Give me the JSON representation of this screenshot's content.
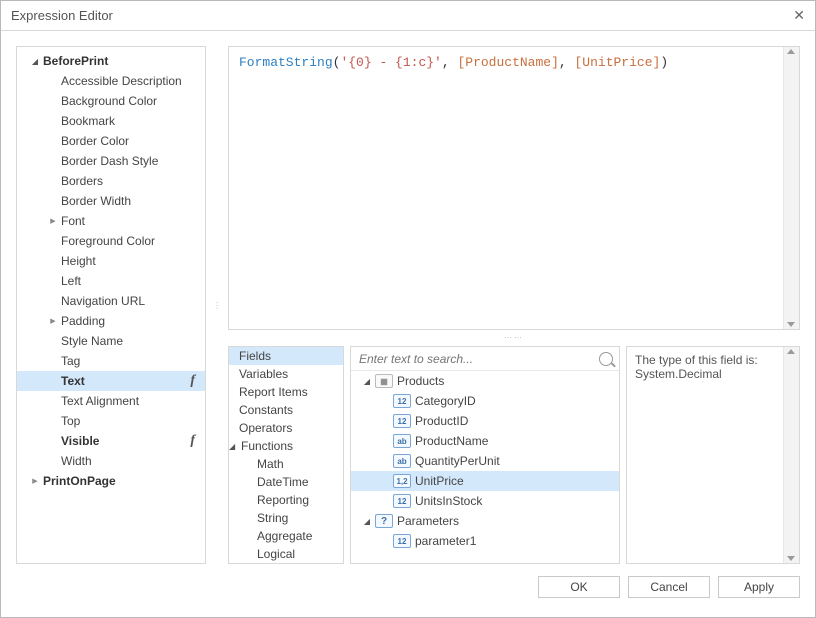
{
  "window": {
    "title": "Expression Editor"
  },
  "left_tree": [
    {
      "label": "BeforePrint",
      "depth": 0,
      "arrow": "down",
      "bold": true,
      "fx": false,
      "selected": false
    },
    {
      "label": "Accessible Description",
      "depth": 1,
      "arrow": "none",
      "bold": false,
      "fx": false
    },
    {
      "label": "Background Color",
      "depth": 1,
      "arrow": "none",
      "bold": false,
      "fx": false
    },
    {
      "label": "Bookmark",
      "depth": 1,
      "arrow": "none",
      "bold": false,
      "fx": false
    },
    {
      "label": "Border Color",
      "depth": 1,
      "arrow": "none",
      "bold": false,
      "fx": false
    },
    {
      "label": "Border Dash Style",
      "depth": 1,
      "arrow": "none",
      "bold": false,
      "fx": false
    },
    {
      "label": "Borders",
      "depth": 1,
      "arrow": "none",
      "bold": false,
      "fx": false
    },
    {
      "label": "Border Width",
      "depth": 1,
      "arrow": "none",
      "bold": false,
      "fx": false
    },
    {
      "label": "Font",
      "depth": 1,
      "arrow": "right",
      "bold": false,
      "fx": false
    },
    {
      "label": "Foreground Color",
      "depth": 1,
      "arrow": "none",
      "bold": false,
      "fx": false
    },
    {
      "label": "Height",
      "depth": 1,
      "arrow": "none",
      "bold": false,
      "fx": false
    },
    {
      "label": "Left",
      "depth": 1,
      "arrow": "none",
      "bold": false,
      "fx": false
    },
    {
      "label": "Navigation URL",
      "depth": 1,
      "arrow": "none",
      "bold": false,
      "fx": false
    },
    {
      "label": "Padding",
      "depth": 1,
      "arrow": "right",
      "bold": false,
      "fx": false
    },
    {
      "label": "Style Name",
      "depth": 1,
      "arrow": "none",
      "bold": false,
      "fx": false
    },
    {
      "label": "Tag",
      "depth": 1,
      "arrow": "none",
      "bold": false,
      "fx": false
    },
    {
      "label": "Text",
      "depth": 1,
      "arrow": "none",
      "bold": true,
      "fx": true,
      "selected": true
    },
    {
      "label": "Text Alignment",
      "depth": 1,
      "arrow": "none",
      "bold": false,
      "fx": false
    },
    {
      "label": "Top",
      "depth": 1,
      "arrow": "none",
      "bold": false,
      "fx": false
    },
    {
      "label": "Visible",
      "depth": 1,
      "arrow": "none",
      "bold": true,
      "fx": true
    },
    {
      "label": "Width",
      "depth": 1,
      "arrow": "none",
      "bold": false,
      "fx": false
    },
    {
      "label": "PrintOnPage",
      "depth": 0,
      "arrow": "right",
      "bold": true,
      "fx": false
    }
  ],
  "expression": {
    "fn": "FormatString",
    "open": "(",
    "str": "'{0} - {1:c}'",
    "sep1": ", ",
    "field1": "[ProductName]",
    "sep2": ", ",
    "field2": "[UnitPrice]",
    "close": ")"
  },
  "categories": [
    {
      "label": "Fields",
      "sub": false,
      "selected": true
    },
    {
      "label": "Variables",
      "sub": false
    },
    {
      "label": "Report Items",
      "sub": false
    },
    {
      "label": "Constants",
      "sub": false
    },
    {
      "label": "Operators",
      "sub": false
    },
    {
      "label": "Functions",
      "sub": false,
      "arrow": "down"
    },
    {
      "label": "Math",
      "sub": true
    },
    {
      "label": "DateTime",
      "sub": true
    },
    {
      "label": "Reporting",
      "sub": true
    },
    {
      "label": "String",
      "sub": true
    },
    {
      "label": "Aggregate",
      "sub": true
    },
    {
      "label": "Logical",
      "sub": true
    }
  ],
  "search": {
    "placeholder": "Enter text to search..."
  },
  "fields_tree": [
    {
      "label": "Products",
      "depth": 0,
      "arrow": "down",
      "icon": "grid"
    },
    {
      "label": "CategoryID",
      "depth": 1,
      "arrow": "none",
      "icon": "12"
    },
    {
      "label": "ProductID",
      "depth": 1,
      "arrow": "none",
      "icon": "12"
    },
    {
      "label": "ProductName",
      "depth": 1,
      "arrow": "none",
      "icon": "ab"
    },
    {
      "label": "QuantityPerUnit",
      "depth": 1,
      "arrow": "none",
      "icon": "ab"
    },
    {
      "label": "UnitPrice",
      "depth": 1,
      "arrow": "none",
      "icon": "1,2",
      "selected": true
    },
    {
      "label": "UnitsInStock",
      "depth": 1,
      "arrow": "none",
      "icon": "12"
    },
    {
      "label": "Parameters",
      "depth": 0,
      "arrow": "down",
      "icon": "?"
    },
    {
      "label": "parameter1",
      "depth": 1,
      "arrow": "none",
      "icon": "12"
    }
  ],
  "description": {
    "line1": "The type of this field is:",
    "line2": "System.Decimal"
  },
  "buttons": {
    "ok": "OK",
    "cancel": "Cancel",
    "apply": "Apply"
  }
}
